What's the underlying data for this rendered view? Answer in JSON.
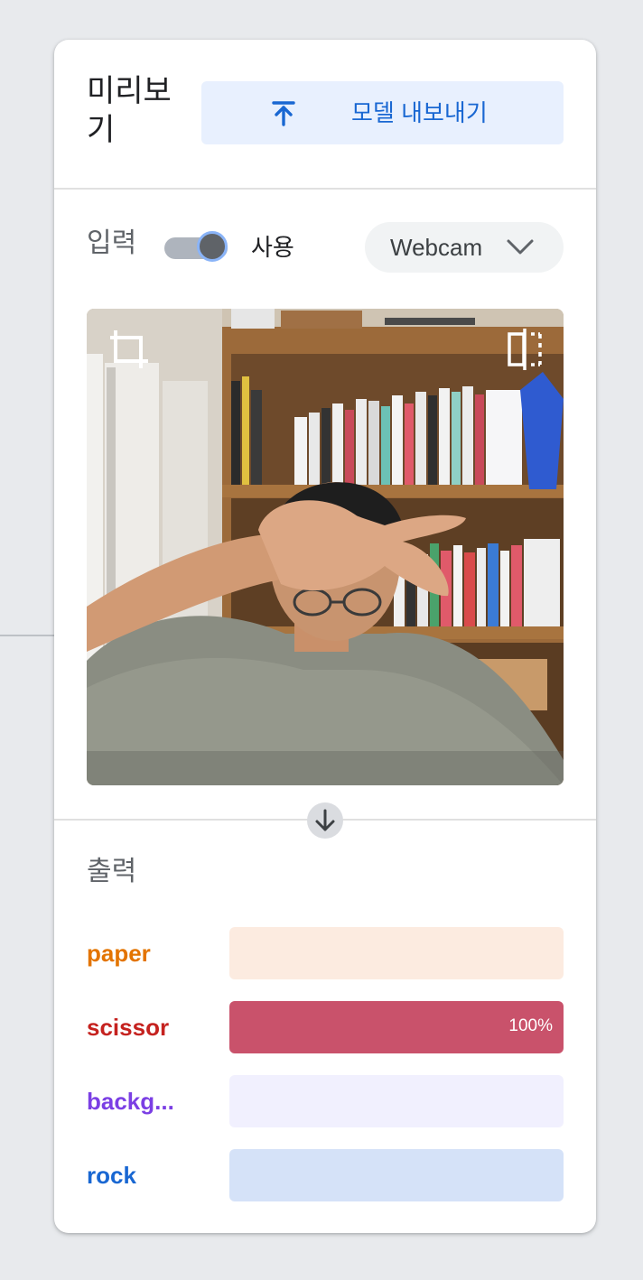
{
  "preview": {
    "title": "미리보\n기",
    "export_label": "모델 내보내기"
  },
  "input": {
    "label": "입력",
    "toggle_on": true,
    "toggle_text": "사용",
    "source": "Webcam"
  },
  "output": {
    "label": "출력",
    "classes": [
      {
        "name": "paper",
        "value": 0,
        "percent_label": "",
        "text_color": "#e37400",
        "bar_bg": "#fcebe0",
        "bar_fill": "#e8710a"
      },
      {
        "name": "scissor",
        "value": 100,
        "percent_label": "100%",
        "text_color": "#c5221f",
        "bar_bg": "#fce8e6",
        "bar_fill": "#c9526b"
      },
      {
        "name": "backg...",
        "value": 0,
        "percent_label": "",
        "text_color": "#7b3fe4",
        "bar_bg": "#f1f0fe",
        "bar_fill": "#7b3fe4"
      },
      {
        "name": "rock",
        "value": 0,
        "percent_label": "",
        "text_color": "#1967d2",
        "bar_bg": "#d5e2f8",
        "bar_fill": "#1967d2"
      }
    ]
  },
  "colors": {
    "accent": "#1967d2",
    "export_bg": "#e8f0fe"
  },
  "icons": {
    "export": "upload-arrow-icon",
    "dropdown": "chevron-down-icon",
    "crop": "crop-icon",
    "flip": "flip-horizontal-icon",
    "flow": "arrow-down-icon"
  }
}
